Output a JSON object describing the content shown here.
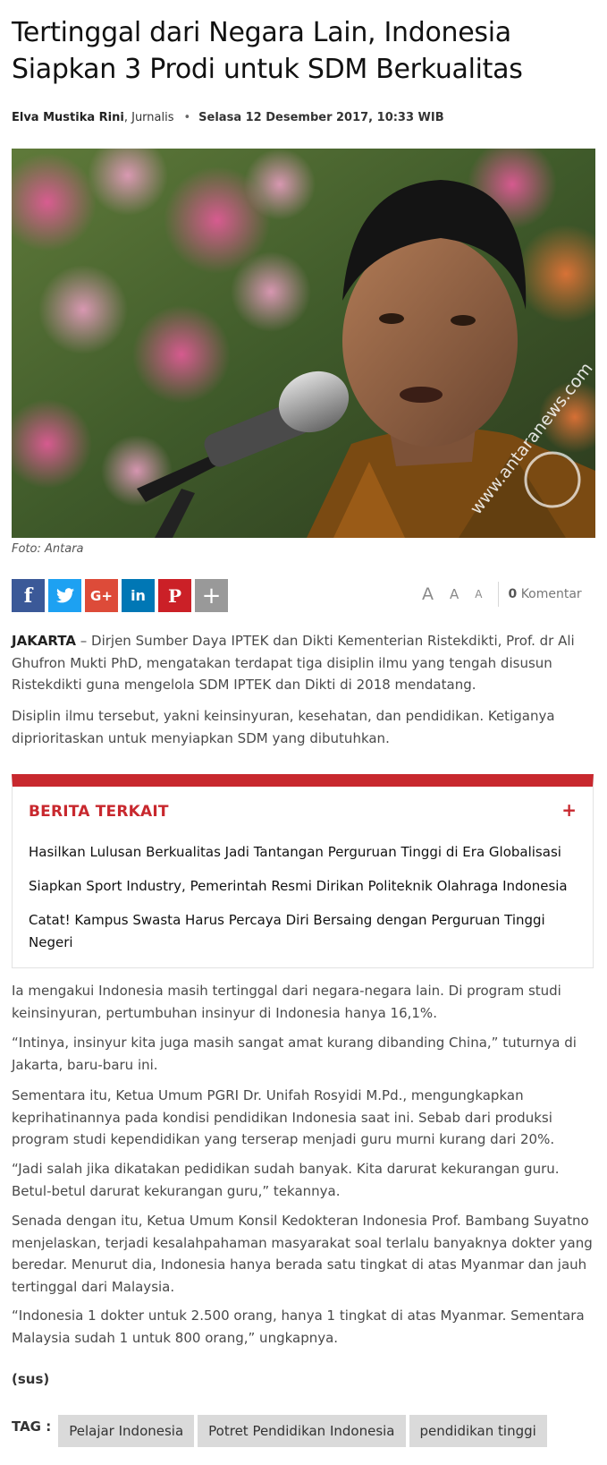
{
  "article": {
    "title": "Tertinggal dari Negara Lain, Indonesia Siapkan 3 Prodi untuk SDM Berkualitas",
    "author": "Elva Mustika Rini",
    "role": ", Jurnalis",
    "separator": "•",
    "date": "Selasa 12 Desember 2017, 10:33 WIB",
    "photo_caption": "Foto: Antara",
    "photo_watermark": "www.antaranews.com"
  },
  "share": {
    "buttons": [
      {
        "name": "facebook",
        "glyph": "f",
        "color": "#3b5998"
      },
      {
        "name": "twitter",
        "glyph": "🐦",
        "color": "#1da1f2"
      },
      {
        "name": "google-plus",
        "glyph": "G+",
        "color": "#dd4b39"
      },
      {
        "name": "linkedin",
        "glyph": "in",
        "color": "#0077b5"
      },
      {
        "name": "pinterest",
        "glyph": "P",
        "color": "#cb2027"
      },
      {
        "name": "more",
        "glyph": "+",
        "color": "#999999"
      }
    ]
  },
  "toolbar": {
    "font_large": "A",
    "font_medium": "A",
    "font_small": "A",
    "comment_count": "0",
    "comment_label": "Komentar"
  },
  "body": {
    "location": "JAKARTA",
    "p1": " – Dirjen Sumber Daya IPTEK dan Dikti Kementerian Ristekdikti, Prof. dr Ali Ghufron Mukti PhD, mengatakan terdapat tiga disiplin ilmu yang tengah disusun Ristekdikti guna mengelola SDM IPTEK dan Dikti di 2018 mendatang.",
    "p2": "Disiplin ilmu tersebut, yakni keinsinyuran, kesehatan, dan pendidikan. Ketiganya diprioritaskan untuk menyiapkan SDM yang dibutuhkan.",
    "p3": "Ia mengakui Indonesia masih tertinggal dari negara-negara lain. Di program studi keinsinyuran, pertumbuhan insinyur di Indonesia hanya 16,1%.",
    "p4": "“Intinya, insinyur kita juga masih sangat amat kurang dibanding China,” tuturnya di Jakarta, baru-baru ini.",
    "p5": "Sementara itu, Ketua Umum PGRI Dr. Unifah Rosyidi M.Pd., mengungkapkan keprihatinannya pada kondisi pendidikan Indonesia saat ini. Sebab dari produksi program studi kependidikan yang terserap menjadi guru murni kurang dari 20%.",
    "p6": "“Jadi salah jika dikatakan pedidikan sudah banyak. Kita darurat kekurangan guru. Betul-betul darurat kekurangan guru,” tekannya.",
    "p7": "Senada dengan itu, Ketua Umum Konsil Kedokteran Indonesia Prof. Bambang Suyatno menjelaskan, terjadi kesalahpahaman masyarakat soal terlalu banyaknya dokter yang beredar. Menurut dia, Indonesia hanya berada satu tingkat di atas Myanmar dan jauh tertinggal dari Malaysia.",
    "p8": "“Indonesia 1 dokter untuk 2.500 orang, hanya 1 tingkat di atas Myanmar. Sementara Malaysia sudah 1 untuk 800 orang,” ungkapnya.",
    "signoff": "(sus)"
  },
  "related": {
    "heading": "BERITA TERKAIT",
    "toggle": "+",
    "items": [
      "Hasilkan Lulusan Berkualitas Jadi Tantangan Perguruan Tinggi di Era Globalisasi",
      "Siapkan Sport Industry, Pemerintah Resmi Dirikan Politeknik Olahraga Indonesia",
      "Catat! Kampus Swasta Harus Percaya Diri Bersaing dengan Perguruan Tinggi Negeri"
    ]
  },
  "tags": {
    "label": "TAG :",
    "items": [
      "Pelajar Indonesia",
      "Potret Pendidikan Indonesia",
      "pendidikan tinggi"
    ]
  }
}
